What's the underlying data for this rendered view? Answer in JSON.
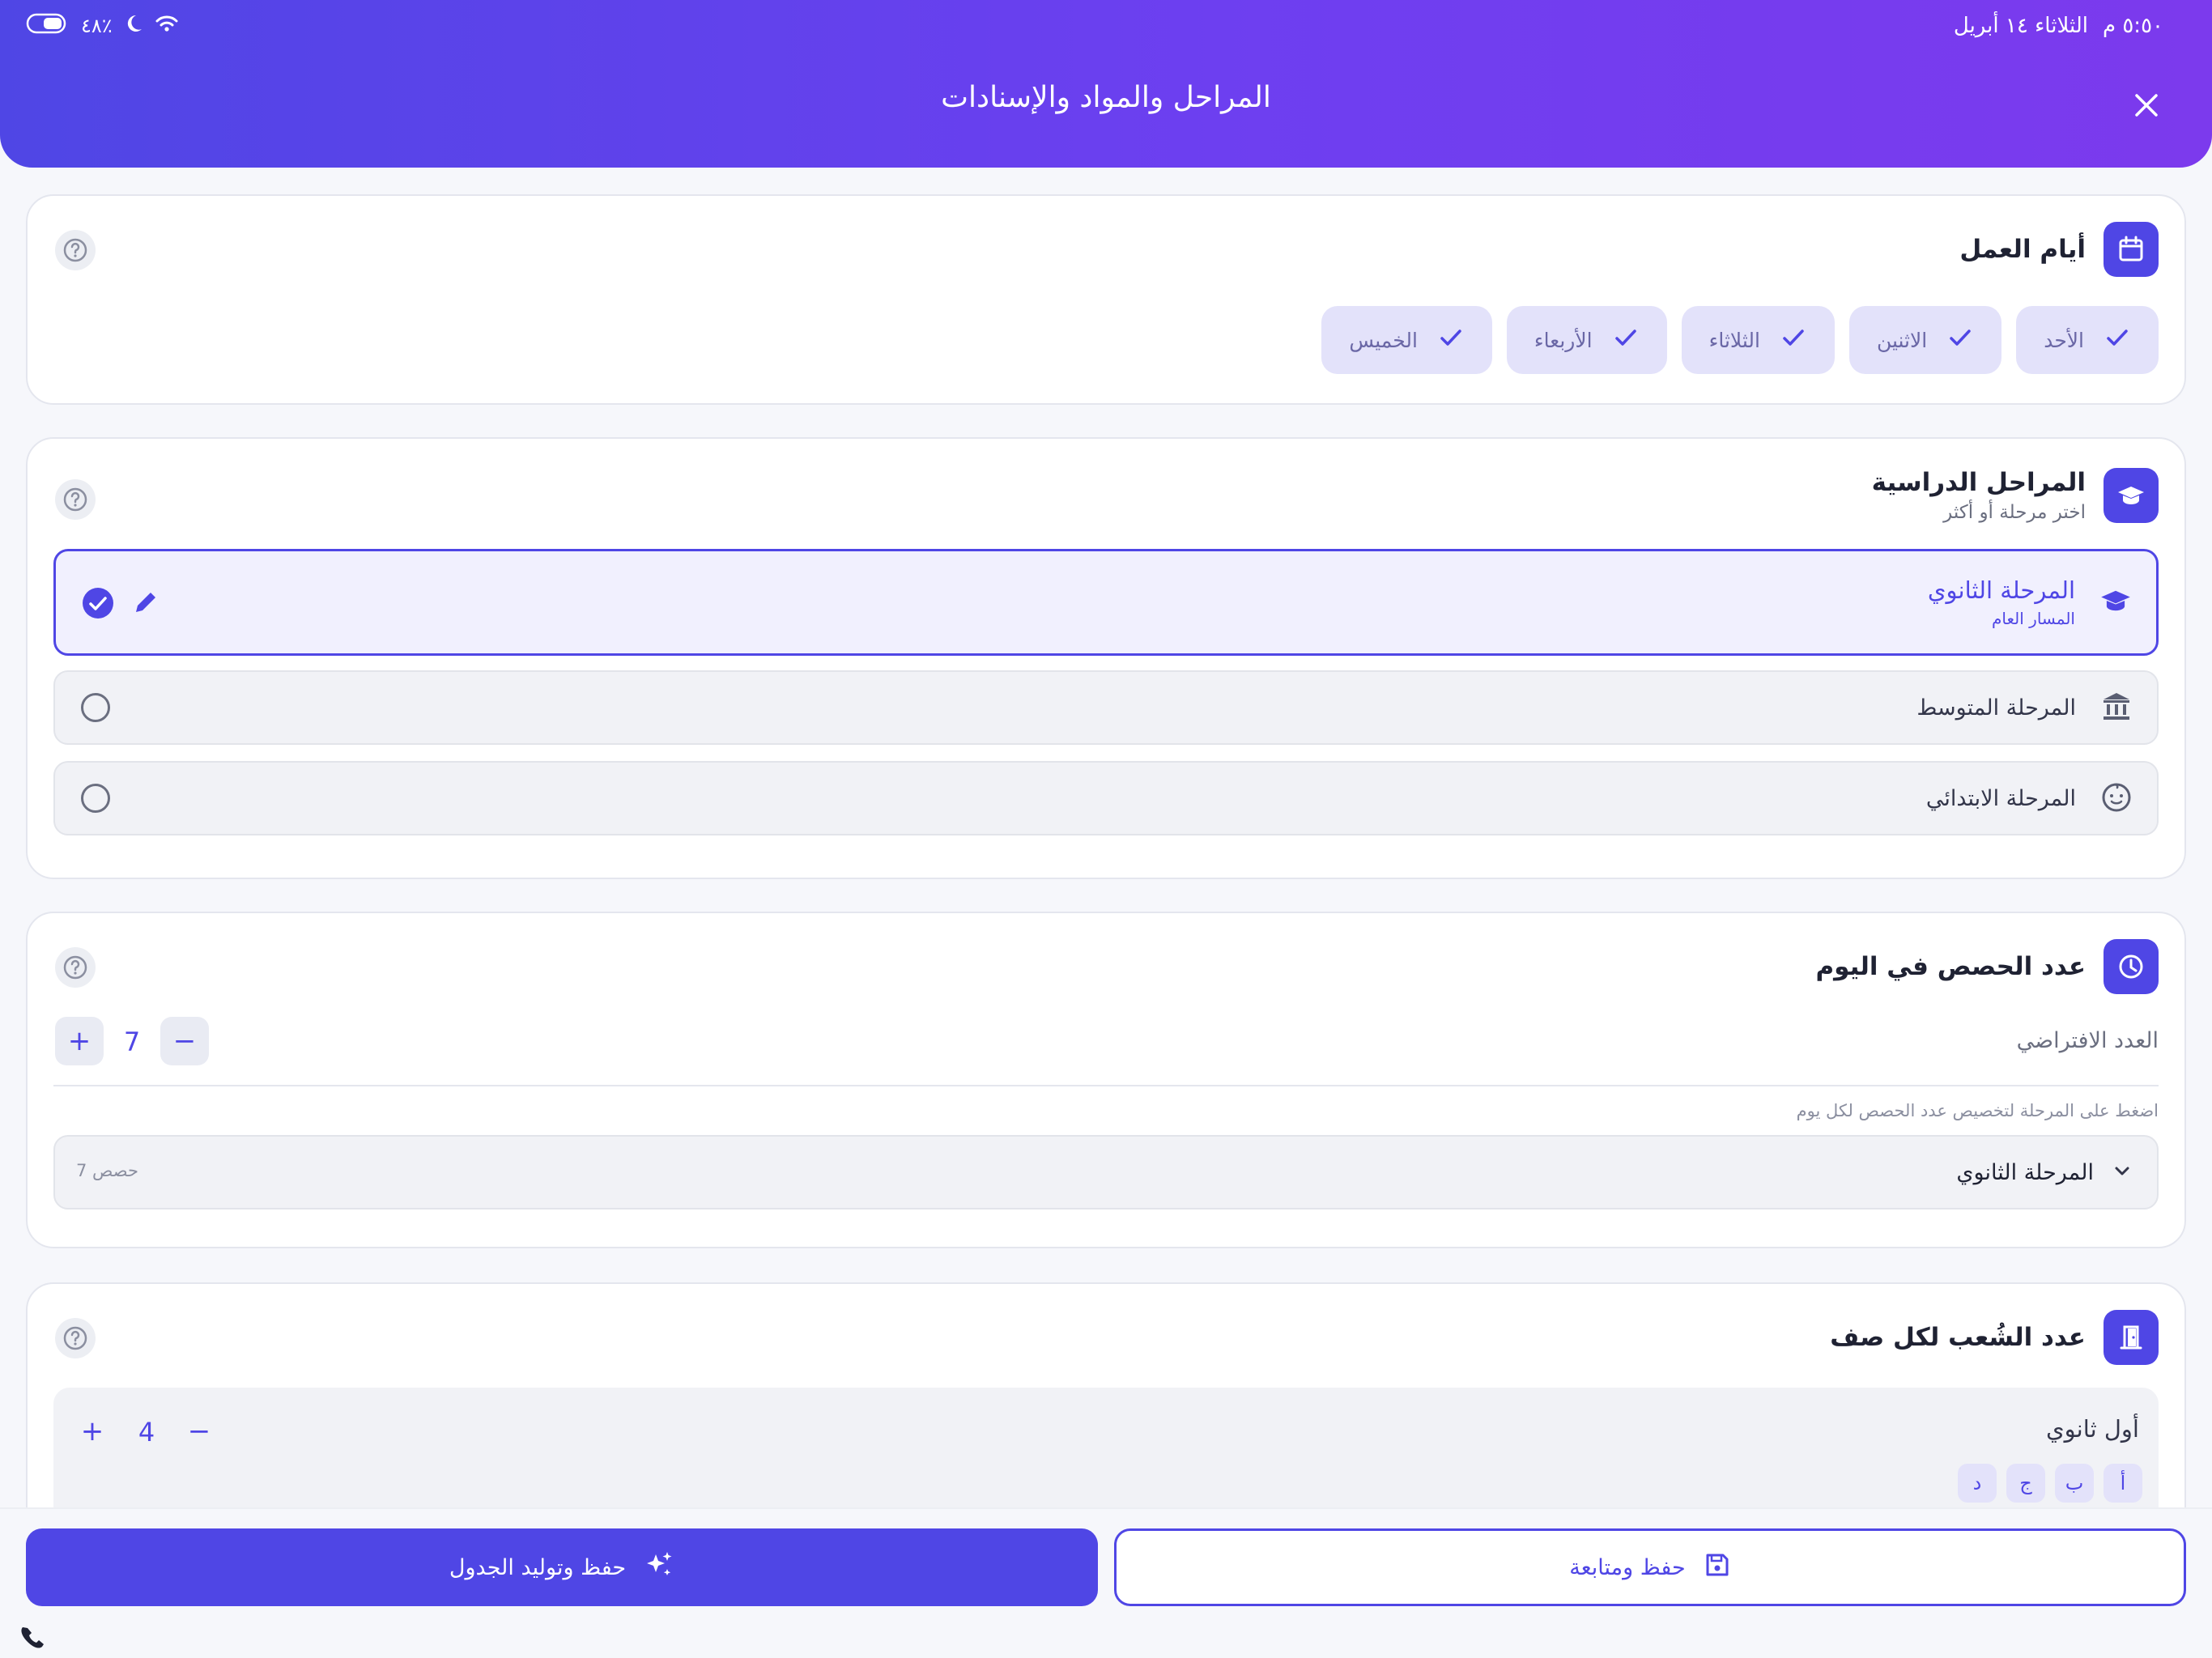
{
  "status_bar": {
    "time": "٥:٥٠ م",
    "date": "الثلاثاء ١٤ أبريل",
    "battery": "٤٨٪"
  },
  "header": {
    "title": "المراحل والمواد والإسنادات"
  },
  "working_days": {
    "title": "أيام العمل",
    "days": [
      "الأحد",
      "الاثنين",
      "الثلاثاء",
      "الأربعاء",
      "الخميس"
    ]
  },
  "stages": {
    "title": "المراحل الدراسية",
    "subtitle": "اختر مرحلة أو أكثر",
    "items": [
      {
        "name": "المرحلة الثانوي",
        "path": "المسار العام",
        "selected": true,
        "icon": "graduation-cap-icon"
      },
      {
        "name": "المرحلة المتوسط",
        "selected": false,
        "icon": "institution-icon"
      },
      {
        "name": "المرحلة الابتدائي",
        "selected": false,
        "icon": "child-face-icon"
      }
    ]
  },
  "periods": {
    "title": "عدد الحصص في اليوم",
    "default_label": "العدد الافتراضي",
    "default_value": "7",
    "hint": "اضغط على المرحلة لتخصيص عدد الحصص لكل يوم",
    "stage_dropdown": {
      "label": "المرحلة الثانوي",
      "count": "7 حصص"
    }
  },
  "sections": {
    "title": "عدد الشُعب لكل صف",
    "grades": [
      {
        "name": "أول ثانوي",
        "count": "4",
        "letters": [
          "أ",
          "ب",
          "ج",
          "د"
        ]
      }
    ]
  },
  "actions": {
    "save_generate": "حفظ وتوليد الجدول",
    "save_continue": "حفظ ومتابعة"
  },
  "colors": {
    "accent": "#4f46e5",
    "header_gradient_end": "#7c3aed",
    "chip_bg": "#e3e2fa"
  }
}
